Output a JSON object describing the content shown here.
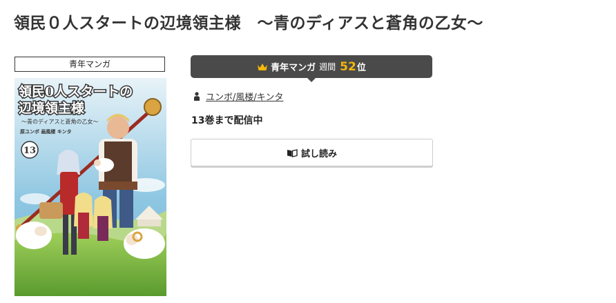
{
  "title": "領民０人スタートの辺境領主様　～青のディアスと蒼角の乙女～",
  "genre_label": "青年マンガ",
  "cover": {
    "title_line1": "領民0人スタートの",
    "title_line2": "辺境領主様",
    "subtitle": "～青のディアスと蒼角の乙女～",
    "credits": "原ユンボ 画風楼 キンタ",
    "volume": "13"
  },
  "ranking": {
    "icon": "crown-icon",
    "genre": "青年マンガ",
    "period": "週間",
    "rank": "52",
    "unit": "位",
    "accent_color": "#f5b80a"
  },
  "authors": {
    "icon": "person-icon",
    "text": "ユンボ/風楼/キンタ"
  },
  "status": "13巻まで配信中",
  "trial_button": {
    "icon": "open-book-icon",
    "label": "試し読み"
  }
}
